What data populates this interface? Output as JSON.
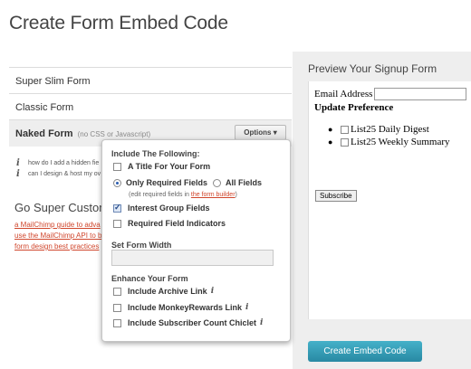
{
  "page_title": "Create Form Embed Code",
  "form_types": {
    "super_slim": "Super Slim Form",
    "classic": "Classic Form",
    "naked": "Naked Form",
    "naked_hint": "(no CSS or Javascript)",
    "options_label": "Options",
    "options_caret": "▾"
  },
  "help_links": [
    "how do I add a hidden fie",
    "can I design & host my ov"
  ],
  "custom": {
    "title": "Go Super Custom",
    "links": [
      "a MailChimp guide to adva",
      "use the MailChimp API to b",
      "form design best practices"
    ]
  },
  "options_panel": {
    "include_heading": "Include The Following:",
    "title_option": "A Title For Your Form",
    "only_required": "Only Required Fields",
    "all_fields": "All Fields",
    "note_prefix": "(edit required fields in",
    "note_link": "the form builder",
    "note_suffix": ")",
    "interest_groups": "Interest Group Fields",
    "required_indicators": "Required Field Indicators",
    "width_heading": "Set Form Width",
    "width_value": "",
    "enhance_heading": "Enhance Your Form",
    "archive_link": "Include Archive Link",
    "monkey_rewards": "Include MonkeyRewards Link",
    "subscriber_count": "Include Subscriber Count Chiclet",
    "info_icon": "i"
  },
  "preview": {
    "title": "Preview Your Signup Form",
    "email_label": "Email Address",
    "email_value": "",
    "update_pref": "Update Preference",
    "lists": [
      "List25 Daily Digest",
      "List25 Weekly Summary"
    ],
    "subscribe_label": "Subscribe"
  },
  "embed_button": "Create Embed Code",
  "colors": {
    "link": "#d0462c",
    "embed_button": "#3aa0ba",
    "panel_bg": "#eeeeee"
  }
}
